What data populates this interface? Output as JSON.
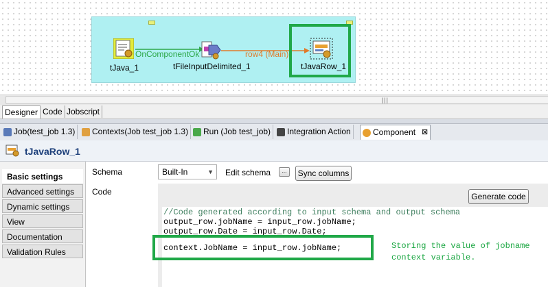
{
  "designer": {
    "components": [
      {
        "label": "tJava_1"
      },
      {
        "label": "tFileInputDelimited_1"
      },
      {
        "label": "tJavaRow_1"
      }
    ],
    "connections": [
      {
        "label": "OnComponentOk",
        "color": "#2ea84a"
      },
      {
        "label": "row4 (Main)",
        "color": "#e07a2a"
      }
    ],
    "subjob_color": "#aff0f2"
  },
  "designer_tabs": [
    "Designer",
    "Code",
    "Jobscript"
  ],
  "view_tabs": [
    {
      "label": "Job(test_job 1.3)",
      "icon": "job-icon"
    },
    {
      "label": "Contexts(Job test_job 1.3)",
      "icon": "contexts-icon"
    },
    {
      "label": "Run (Job test_job)",
      "icon": "run-icon"
    },
    {
      "label": "Integration Action",
      "icon": "integration-icon"
    },
    {
      "label": "Component",
      "icon": "component-icon",
      "close": "⊠"
    }
  ],
  "component_title": "tJavaRow_1",
  "left_nav": [
    "Basic settings",
    "Advanced settings",
    "Dynamic settings",
    "View",
    "Documentation",
    "Validation Rules"
  ],
  "settings": {
    "schema_label": "Schema",
    "schema_value": "Built-In",
    "edit_schema_label": "Edit schema",
    "edit_schema_button": "...",
    "sync_columns_label": "Sync columns",
    "code_label": "Code",
    "generate_code_label": "Generate code"
  },
  "code_lines": [
    "//Code generated according to input schema and output schema",
    "output_row.jobName = input_row.jobName;",
    "output_row.Date = input_row.Date;",
    "context.JobName = input_row.jobName;"
  ],
  "annotation": {
    "line1": "Storing the value of jobname",
    "line2": "context variable.",
    "color": "#1aa641"
  },
  "highlight_color": "#20a848"
}
